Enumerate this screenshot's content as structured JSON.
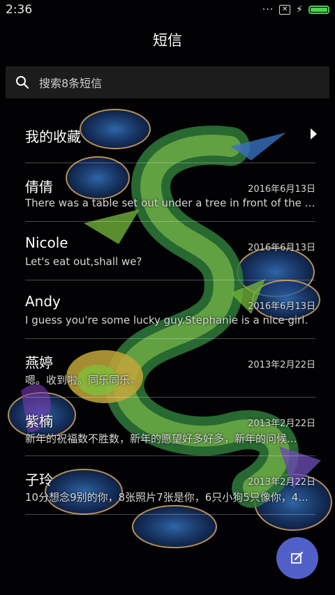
{
  "status_bar": {
    "time": "2:36",
    "more_dots": "···",
    "sim_icon": "no-sim-icon",
    "charging_icon": "bolt-icon",
    "battery_icon": "battery-icon",
    "battery_color": "#4fd04f"
  },
  "header": {
    "title": "短信"
  },
  "search": {
    "placeholder": "搜索8条短信",
    "icon": "search-icon"
  },
  "favorites": {
    "label": "我的收藏",
    "icon": "chevron-right-icon"
  },
  "conversations": [
    {
      "name": "倩倩",
      "date": "2016年6月13日",
      "preview": "There was a table set out under a tree in front of the ho..."
    },
    {
      "name": "Nicole",
      "date": "2016年6月13日",
      "preview": "Let's eat out,shall we?"
    },
    {
      "name": "Andy",
      "date": "2016年6月13日",
      "preview": "I guess you're some lucky guy.Stephanie is a nice girl."
    },
    {
      "name": "燕婷",
      "date": "2013年2月22日",
      "preview": "嗯。收到啦。同乐同乐。"
    },
    {
      "name": "紫楠",
      "date": "2013年2月22日",
      "preview": "新年的祝福数不胜数，新年的愿望好多好多，新年的问候..."
    },
    {
      "name": "子玲",
      "date": "2013年2月22日",
      "preview": "10分想念9别的你，8张照片7张是你，6只小狗5只像你，4..."
    }
  ],
  "fab": {
    "icon": "compose-icon",
    "color": "#5160c8"
  }
}
